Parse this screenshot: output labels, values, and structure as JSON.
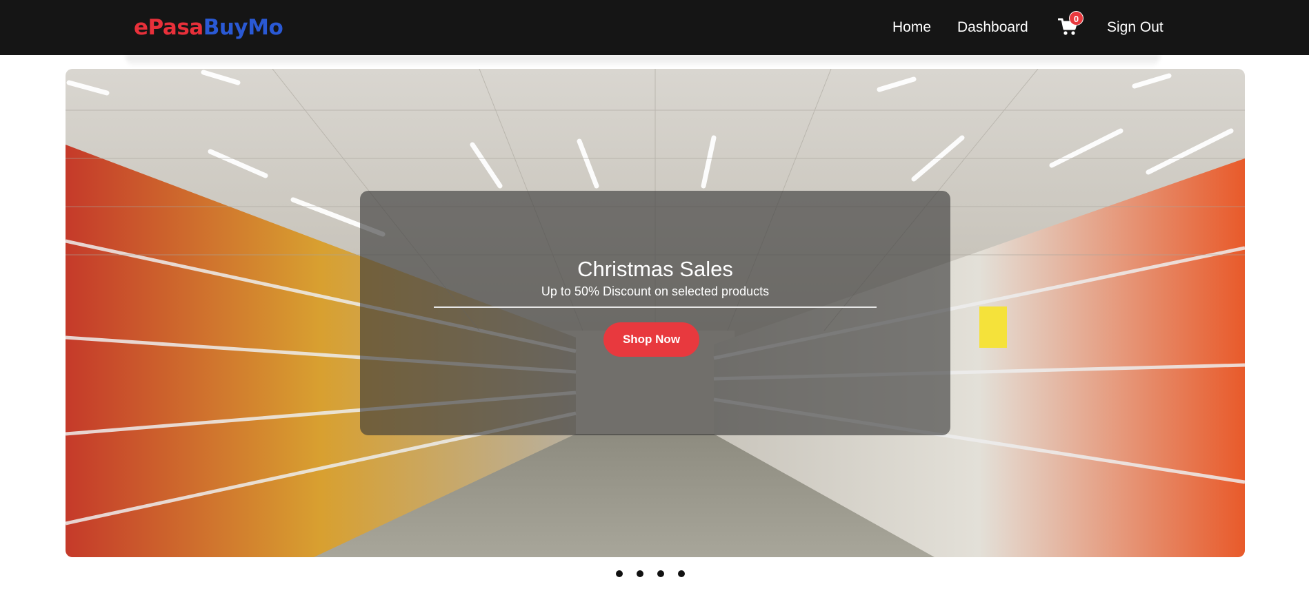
{
  "navbar": {
    "brand_part1": "ePasa",
    "brand_part2": "BuyMo",
    "links": {
      "home": "Home",
      "dashboard": "Dashboard",
      "sign_out": "Sign Out"
    },
    "cart_icon": "shopping-cart-icon",
    "cart_count": "0"
  },
  "carousel": {
    "background_image": "supermarket aisle photo",
    "caption": {
      "title": "Christmas Sales",
      "subtitle": "Up to 50% Discount on selected products",
      "button": "Shop Now"
    },
    "slide_count": 4
  },
  "colors": {
    "navbar_bg": "#151515",
    "brand_red": "#e8303a",
    "brand_blue": "#2a59d4",
    "accent": "#e8393e"
  }
}
